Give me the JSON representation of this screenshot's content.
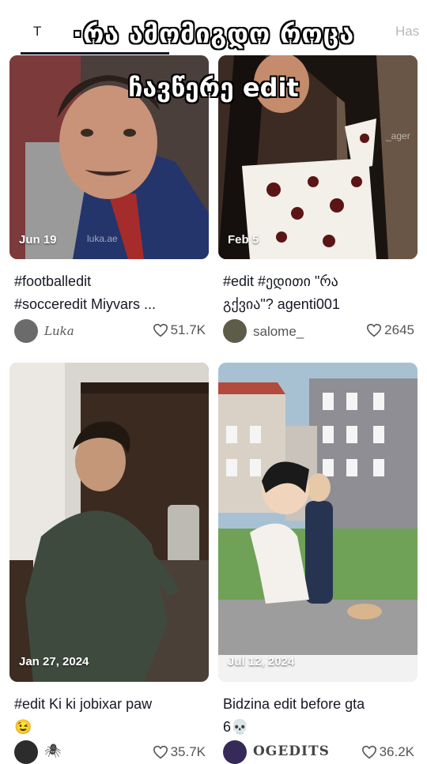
{
  "tabs": {
    "left_label": "T",
    "right_label": "Has"
  },
  "overlay_caption": {
    "line1": "·რა ამომიგდო როცა",
    "line2": "ჩავწერე edit"
  },
  "cards": [
    {
      "date": "Jun 19",
      "watermark": "luka.ae",
      "description_line1": "#footballedit",
      "description_line2": "#socceredit Miyvars ...",
      "author": "Luka",
      "likes": "51.7K"
    },
    {
      "date": "Feb 5",
      "watermark": "_ager",
      "description_line1": "#edit #ედითი \"რა",
      "description_line2": "გქვია\"? agenti001",
      "author": "salome_",
      "likes": "2645"
    },
    {
      "date": "Jan 27, 2024",
      "description_line1": "#edit Ki ki jobixar paw",
      "description_line2": "😉",
      "author": "",
      "likes": "35.7K"
    },
    {
      "date": "Jul 12, 2024",
      "description_line1": "Bidzina edit before gta",
      "description_line2": "6💀",
      "author": "OGEDITS",
      "likes": "36.2K"
    }
  ],
  "colors": {
    "text": "#161823",
    "muted": "#555555",
    "background": "#ffffff"
  }
}
